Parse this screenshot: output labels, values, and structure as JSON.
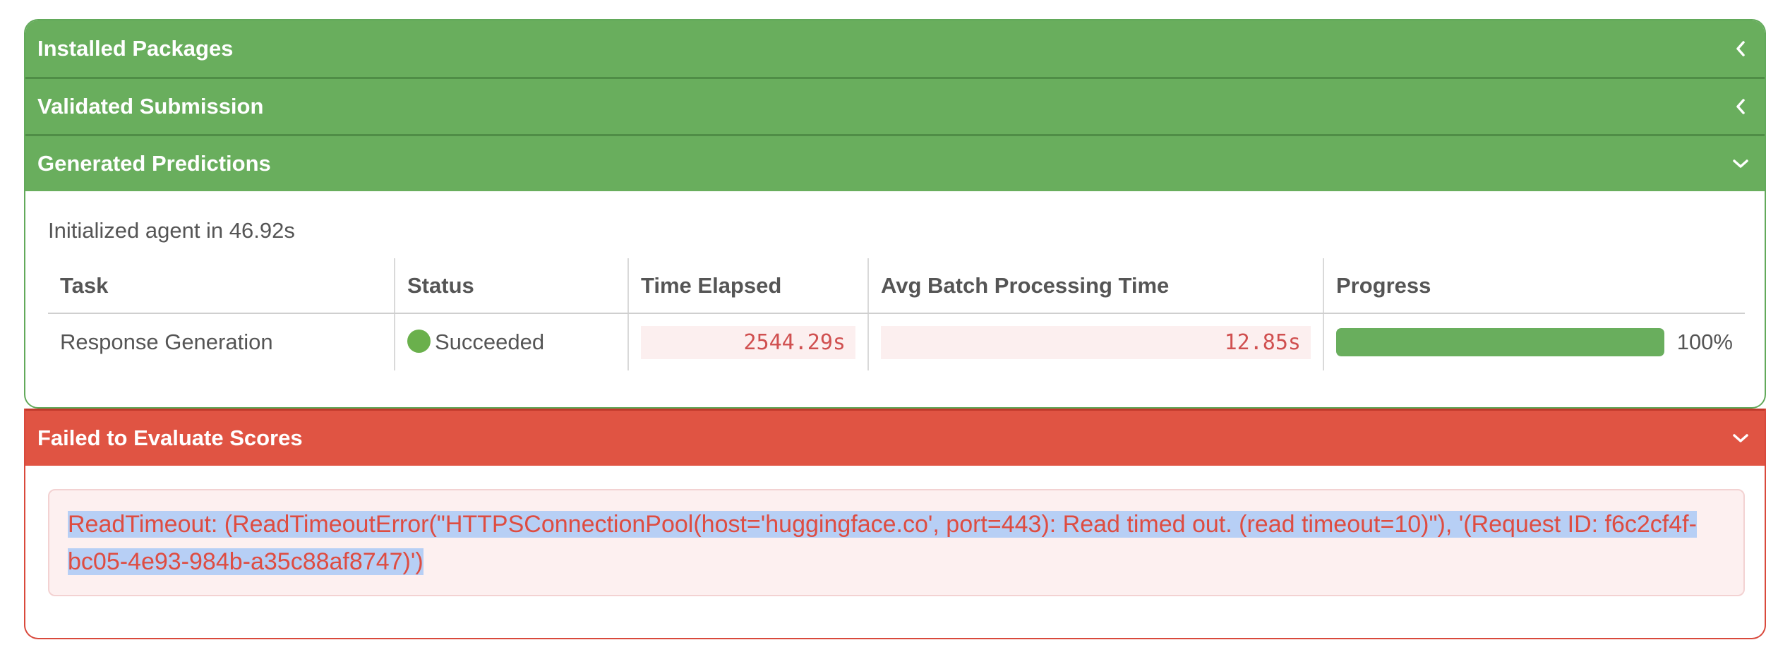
{
  "sections": {
    "installed": "Installed Packages",
    "validated": "Validated Submission",
    "generated": "Generated Predictions",
    "failed": "Failed to Evaluate Scores"
  },
  "generated_body": {
    "init_text": "Initialized agent in 46.92s",
    "columns": [
      "Task",
      "Status",
      "Time Elapsed",
      "Avg Batch Processing Time",
      "Progress"
    ],
    "row": {
      "task": "Response Generation",
      "status": "Succeeded",
      "time_elapsed": "2544.29s",
      "avg_batch": "12.85s",
      "progress_label": "100%",
      "progress_value": 1.0
    }
  },
  "error": {
    "message": "ReadTimeout: (ReadTimeoutError(\"HTTPSConnectionPool(host='huggingface.co', port=443): Read timed out. (read timeout=10)\"), '(Request ID: f6c2cf4f-bc05-4e93-984b-a35c88af8747)')"
  },
  "colors": {
    "success": "#69ae5d",
    "danger": "#e05443",
    "error_text": "#de4c41",
    "selection": "#b7cff5"
  },
  "icons": {
    "collapsed": "chevron-left-icon",
    "expanded": "chevron-down-icon"
  }
}
